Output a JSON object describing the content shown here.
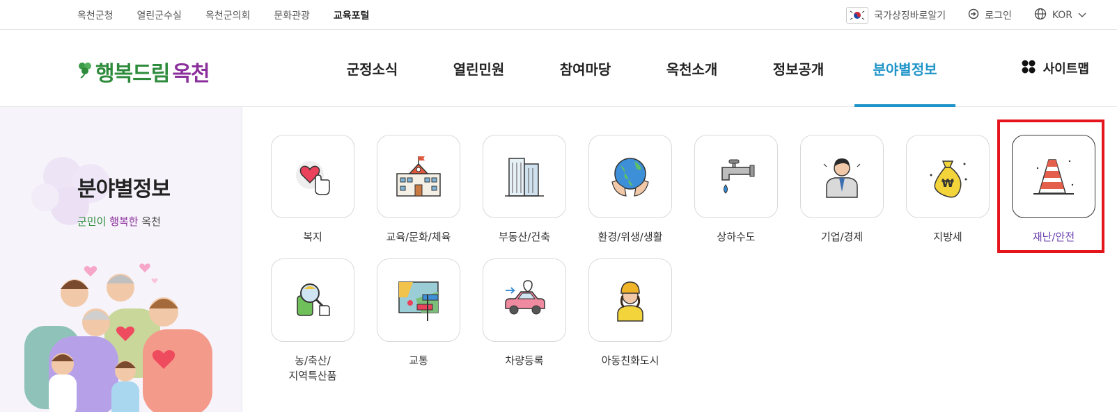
{
  "topbar": {
    "links": [
      "옥천군청",
      "열린군수실",
      "옥천군의회",
      "문화관광",
      "교육포털"
    ],
    "active_link": "교육포털",
    "national_symbol": "국가상징바로알기",
    "login": "로그인",
    "language": "KOR"
  },
  "header": {
    "logo_part1": "행복드림",
    "logo_part2": "옥천",
    "nav": [
      "군정소식",
      "열린민원",
      "참여마당",
      "옥천소개",
      "정보공개",
      "분야별정보"
    ],
    "active_nav": "분야별정보",
    "sitemap": "사이트맵"
  },
  "sidebar": {
    "title": "분야별정보",
    "subtitle_part1": "군민이",
    "subtitle_part2": "행복한",
    "subtitle_part3": "옥천"
  },
  "tiles": [
    {
      "label": "복지",
      "icon": "heart-hand-icon"
    },
    {
      "label": "교육/문화/체육",
      "icon": "school-icon"
    },
    {
      "label": "부동산/건축",
      "icon": "buildings-icon"
    },
    {
      "label": "환경/위생/생활",
      "icon": "earth-hands-icon"
    },
    {
      "label": "상하수도",
      "icon": "faucet-icon"
    },
    {
      "label": "기업/경제",
      "icon": "businessman-icon"
    },
    {
      "label": "지방세",
      "icon": "money-bag-icon"
    },
    {
      "label": "재난/안전",
      "icon": "traffic-cone-icon",
      "selected": true
    },
    {
      "label": "농/축산/\n지역특산품",
      "icon": "magnifier-produce-icon"
    },
    {
      "label": "교통",
      "icon": "map-signpost-icon"
    },
    {
      "label": "차량등록",
      "icon": "car-icon"
    },
    {
      "label": "아동친화도시",
      "icon": "child-icon"
    }
  ],
  "colors": {
    "accent": "#1f94c8",
    "brand_green": "#2e8b3c",
    "brand_purple": "#8a2f9b",
    "highlight": "#e4151b"
  }
}
